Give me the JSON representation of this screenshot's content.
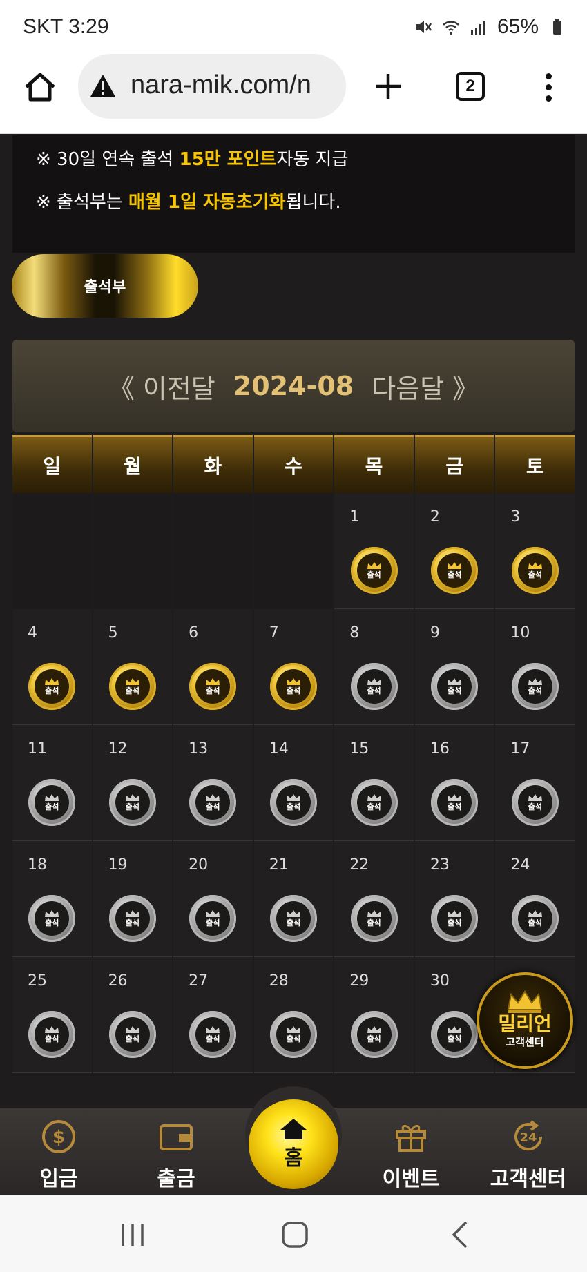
{
  "status_bar": {
    "carrier_time": "SKT 3:29",
    "battery": "65%"
  },
  "browser": {
    "url": "nara-mik.com/n",
    "tab_count": "2"
  },
  "notices": {
    "n1_prefix": "※ 30일 연속 출석 ",
    "n1_highlight": "15만 포인트",
    "n1_suffix": "자동 지급",
    "n2_prefix": "※ 출석부는 ",
    "n2_highlight": "매월 1일 자동초기화",
    "n2_suffix": "됩니다."
  },
  "attendance_button": "출석부",
  "month_nav": {
    "prev": "《 이전달",
    "month": "2024-08",
    "next": "다음달 》"
  },
  "weekdays": [
    "일",
    "월",
    "화",
    "수",
    "목",
    "금",
    "토"
  ],
  "stamp_label": "출석",
  "calendar": {
    "leading_blanks": 4,
    "days": [
      {
        "d": "1",
        "checked": true
      },
      {
        "d": "2",
        "checked": true
      },
      {
        "d": "3",
        "checked": true
      },
      {
        "d": "4",
        "checked": true
      },
      {
        "d": "5",
        "checked": true
      },
      {
        "d": "6",
        "checked": true
      },
      {
        "d": "7",
        "checked": true
      },
      {
        "d": "8",
        "checked": false
      },
      {
        "d": "9",
        "checked": false
      },
      {
        "d": "10",
        "checked": false
      },
      {
        "d": "11",
        "checked": false
      },
      {
        "d": "12",
        "checked": false
      },
      {
        "d": "13",
        "checked": false
      },
      {
        "d": "14",
        "checked": false
      },
      {
        "d": "15",
        "checked": false
      },
      {
        "d": "16",
        "checked": false
      },
      {
        "d": "17",
        "checked": false
      },
      {
        "d": "18",
        "checked": false
      },
      {
        "d": "19",
        "checked": false
      },
      {
        "d": "20",
        "checked": false
      },
      {
        "d": "21",
        "checked": false
      },
      {
        "d": "22",
        "checked": false
      },
      {
        "d": "23",
        "checked": false
      },
      {
        "d": "24",
        "checked": false
      },
      {
        "d": "25",
        "checked": false
      },
      {
        "d": "26",
        "checked": false
      },
      {
        "d": "27",
        "checked": false
      },
      {
        "d": "28",
        "checked": false
      },
      {
        "d": "29",
        "checked": false
      },
      {
        "d": "30",
        "checked": false
      },
      {
        "d": "",
        "checked": false
      }
    ]
  },
  "floating_support": {
    "title": "밀리언",
    "subtitle": "고객센터"
  },
  "bottom_nav": {
    "deposit": "입금",
    "withdraw": "출금",
    "home": "홈",
    "event": "이벤트",
    "support": "고객센터"
  },
  "colors": {
    "gold": "#f6c400",
    "background": "#1e1c1d"
  }
}
